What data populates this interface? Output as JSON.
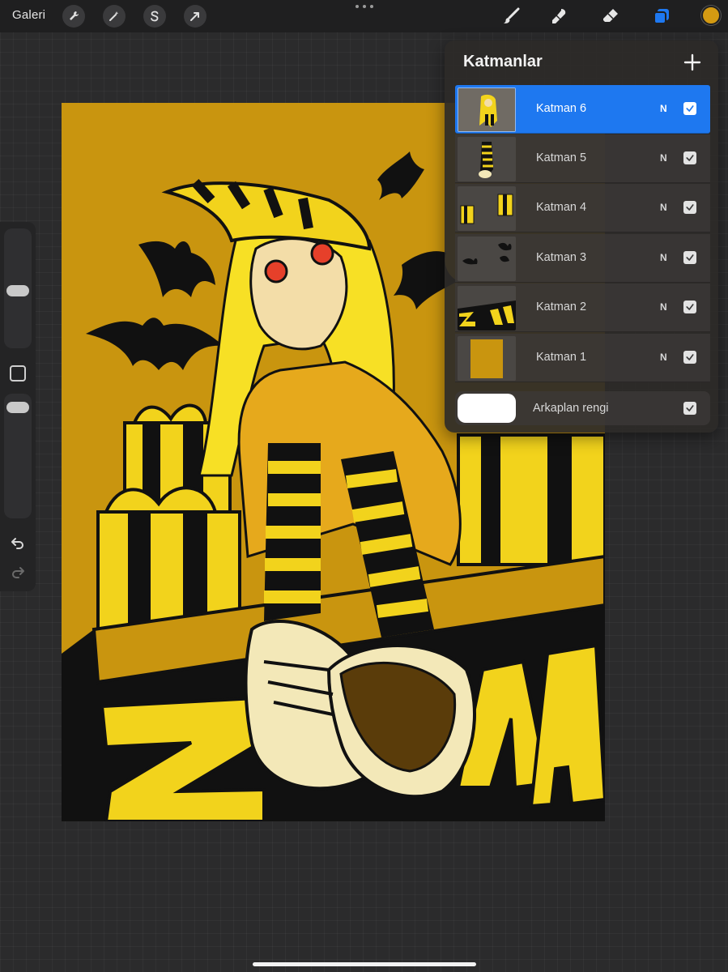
{
  "toolbar": {
    "gallery_label": "Galeri",
    "left_tools": [
      "wrench-icon",
      "magic-wand-icon",
      "selection-s-icon",
      "transform-arrow-icon"
    ],
    "right_tools": [
      "brush-icon",
      "smudge-icon",
      "eraser-icon",
      "layers-icon"
    ],
    "active_color": "#d49a12",
    "accent": "#1e78f0"
  },
  "layers_panel": {
    "title": "Katmanlar",
    "layers": [
      {
        "name": "Katman 6",
        "blend": "N",
        "visible": true,
        "selected": true
      },
      {
        "name": "Katman 5",
        "blend": "N",
        "visible": true,
        "selected": false
      },
      {
        "name": "Katman 4",
        "blend": "N",
        "visible": true,
        "selected": false
      },
      {
        "name": "Katman 3",
        "blend": "N",
        "visible": true,
        "selected": false
      },
      {
        "name": "Katman 2",
        "blend": "N",
        "visible": true,
        "selected": false
      },
      {
        "name": "Katman 1",
        "blend": "N",
        "visible": true,
        "selected": false
      }
    ],
    "background": {
      "label": "Arkaplan rengi",
      "color": "#ffffff",
      "visible": true
    }
  },
  "canvas": {
    "artwork_text": "ZEMIA",
    "background_color": "#c9950f"
  }
}
